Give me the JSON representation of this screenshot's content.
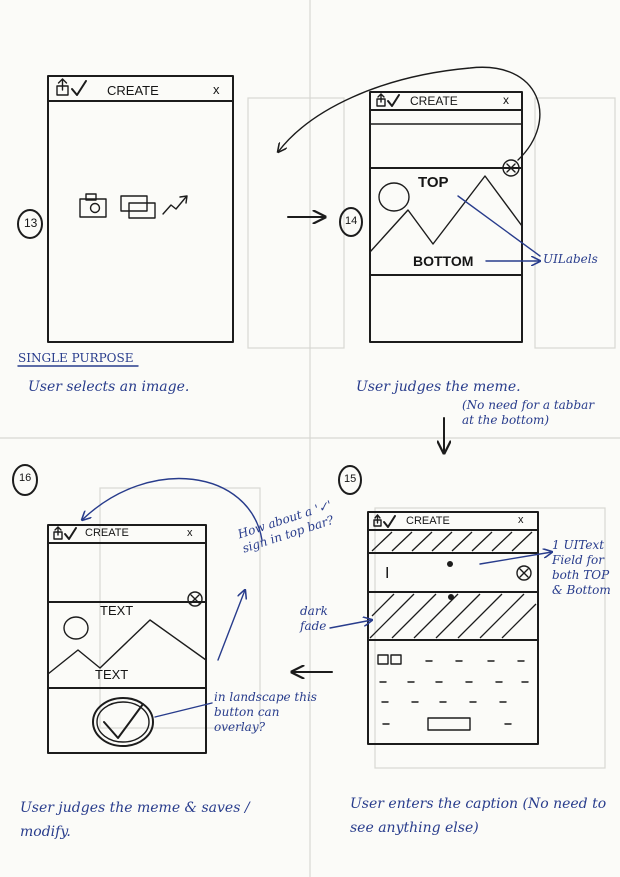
{
  "screens": {
    "s13": {
      "number": "13",
      "header": {
        "title": "CREATE",
        "close": "x"
      }
    },
    "s14": {
      "number": "14",
      "header": {
        "title": "CREATE",
        "close": "x"
      },
      "top_text": "TOP",
      "bottom_text": "BOTTOM"
    },
    "s15": {
      "number": "15",
      "header": {
        "title": "CREATE",
        "close": "x"
      },
      "cursor_mark": "I"
    },
    "s16": {
      "number": "16",
      "header": {
        "title": "CREATE",
        "close": "x"
      },
      "top_text": "TEXT",
      "bottom_text": "TEXT"
    }
  },
  "annotations": {
    "single_purpose": "SINGLE PURPOSE",
    "caption_13": "User selects an image.",
    "caption_14": "User judges the meme.",
    "note_14": "(No need for a tabbar at the bottom)",
    "uilabels": "UILabels",
    "uitextfield": "1 UIText Field for both TOP & Bottom",
    "dark_fade": "dark fade",
    "tick_question": "How about a '✓' sign in top bar?",
    "landscape_note": "in landscape this button can overlay?",
    "caption_16": "User judges the meme & saves / modify.",
    "caption_15": "User enters the caption (No need to see anything else)"
  }
}
